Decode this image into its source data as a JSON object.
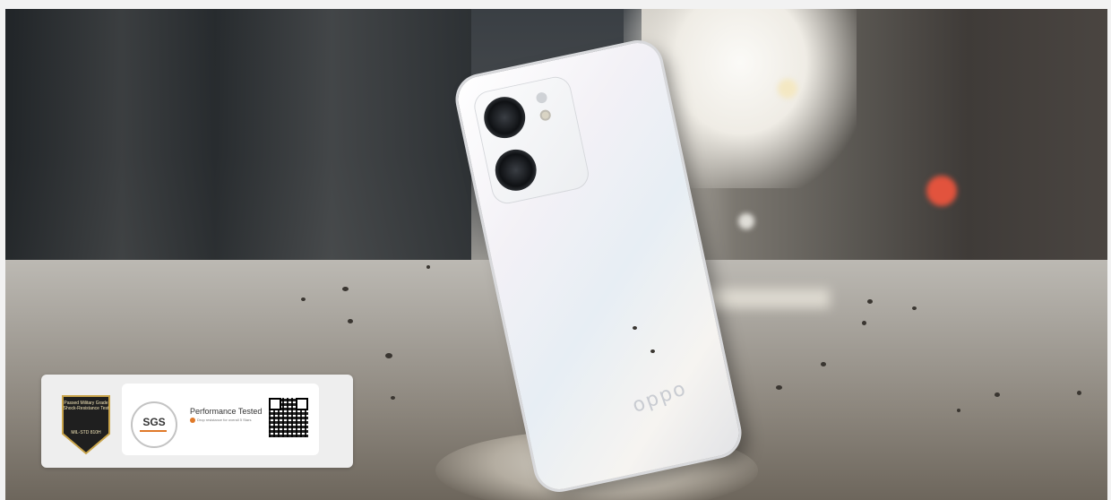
{
  "badge": {
    "military_text": "Passed Military Grade Shock-Resistance Test",
    "military_std": "MIL-STD 810H",
    "sgs_logo": "SGS",
    "sgs_title": "Performance Tested",
    "sgs_sub": "Drop resistance for overall 5 Stars"
  },
  "phone": {
    "brand": "oppo"
  },
  "colors": {
    "sgs_accent": "#e07a2a",
    "shield_gold": "#c9a44a"
  }
}
